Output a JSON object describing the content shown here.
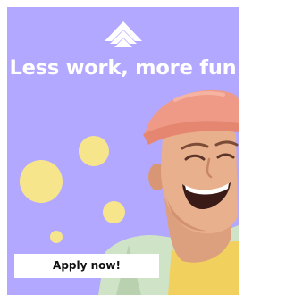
{
  "ad": {
    "headline": "Less work, more fun",
    "cta_label": "Apply now!",
    "logo_icon": "triangle-stack-logo-icon",
    "colors": {
      "background": "#b3a8ff",
      "accent_dots": "#f7e58c",
      "headline_text": "#ffffff",
      "button_background": "#ffffff"
    }
  }
}
